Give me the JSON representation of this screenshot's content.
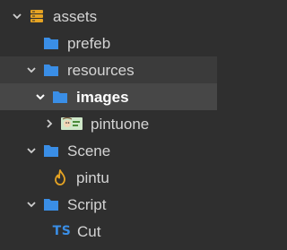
{
  "colors": {
    "background": "#2f2f2f",
    "folder": "#3a8ee6",
    "db": "#e5a323",
    "flame": "#e5a323",
    "selected_bg": "#474747",
    "hover_bg": "#3b3b3b",
    "text": "#d4d4d4"
  },
  "tree": {
    "items": [
      {
        "label": "assets",
        "icon": "database-icon",
        "expanded": true
      },
      {
        "label": "prefeb",
        "icon": "folder-icon"
      },
      {
        "label": "resources",
        "icon": "folder-icon",
        "expanded": true
      },
      {
        "label": "images",
        "icon": "folder-icon",
        "expanded": true,
        "selected": true
      },
      {
        "label": "pintuone",
        "icon": "image-atlas-icon",
        "expanded": false
      },
      {
        "label": "Scene",
        "icon": "folder-icon",
        "expanded": true
      },
      {
        "label": "pintu",
        "icon": "scene-flame-icon"
      },
      {
        "label": "Script",
        "icon": "folder-icon",
        "expanded": true
      },
      {
        "label": "Cut",
        "icon": "typescript-icon",
        "icon_text": "TS"
      }
    ]
  }
}
